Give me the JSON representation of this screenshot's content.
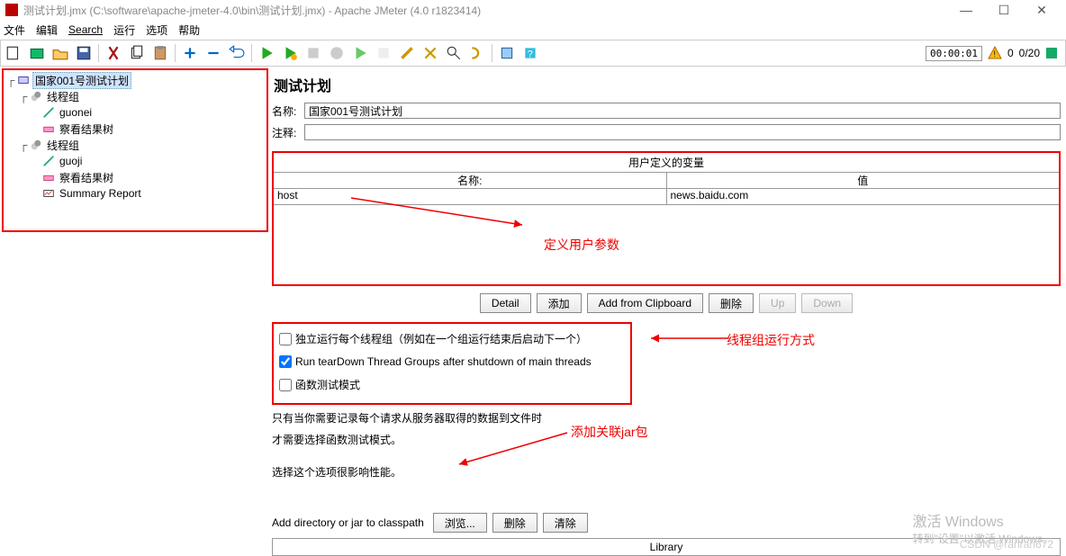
{
  "titlebar": {
    "title": "测试计划.jmx (C:\\software\\apache-jmeter-4.0\\bin\\测试计划.jmx) - Apache JMeter (4.0 r1823414)"
  },
  "menu": {
    "file": "文件",
    "edit": "编辑",
    "search": "Search",
    "run": "运行",
    "options": "选项",
    "help": "帮助"
  },
  "toolbar": {
    "timer": "00:00:01",
    "warn_count": "0",
    "run_state": "0/20"
  },
  "tree": {
    "root": "国家001号测试计划",
    "tg1": "线程组",
    "guonei": "guonei",
    "vrt1": "察看结果树",
    "tg2": "线程组",
    "guoji": "guoji",
    "vrt2": "察看结果树",
    "summary": "Summary Report"
  },
  "panel": {
    "title": "测试计划",
    "name_label": "名称:",
    "name_value": "国家001号测试计划",
    "comment_label": "注释:",
    "comment_value": ""
  },
  "vars": {
    "heading": "用户定义的变量",
    "col_name": "名称:",
    "col_value": "值",
    "row": {
      "name": "host",
      "value": "news.baidu.com"
    },
    "buttons": {
      "detail": "Detail",
      "add": "添加",
      "clip": "Add from Clipboard",
      "del": "删除",
      "up": "Up",
      "down": "Down"
    }
  },
  "checks": {
    "c1": "独立运行每个线程组（例如在一个组运行结束后启动下一个）",
    "c2": "Run tearDown Thread Groups after shutdown of main threads",
    "c3": "函数测试模式"
  },
  "notes": {
    "n1": "只有当你需要记录每个请求从服务器取得的数据到文件时",
    "n2": "才需要选择函数测试模式。",
    "n3": "选择这个选项很影响性能。"
  },
  "classpath": {
    "label": "Add directory or jar to classpath",
    "browse": "浏览...",
    "del": "删除",
    "clear": "清除",
    "lib": "Library"
  },
  "anno": {
    "a1": "定义用户参数",
    "a2": "线程组运行方式",
    "a3": "添加关联jar包"
  },
  "watermark": {
    "l1": "激活 Windows",
    "l2": "转到\"设置\"以激活 Windows。",
    "csdn": "CSDN @ranran672"
  }
}
